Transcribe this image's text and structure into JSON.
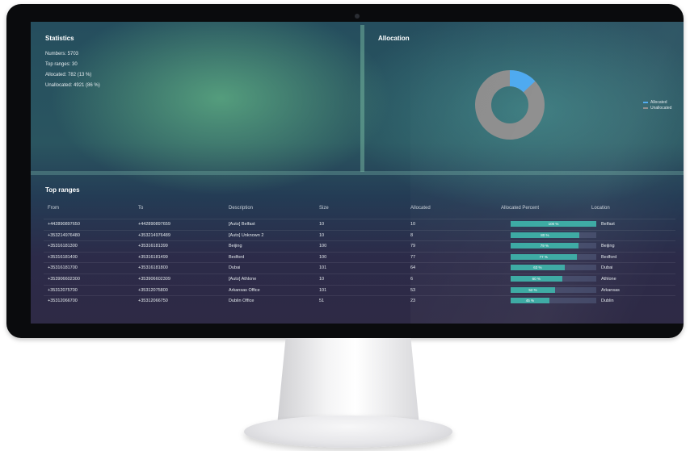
{
  "statistics": {
    "title": "Statistics",
    "lines": [
      "Numbers: 5703",
      "Top ranges: 30",
      "Allocated: 782 (13 %)",
      "Unallocated: 4921 (86 %)"
    ]
  },
  "allocation": {
    "title": "Allocation",
    "legend": [
      {
        "label": "Allocated",
        "color": "#4aa8f0"
      },
      {
        "label": "Unallocated",
        "color": "#8c8c8c"
      }
    ],
    "allocated_fraction": 0.13
  },
  "top_ranges": {
    "title": "Top ranges",
    "columns": [
      "From",
      "To",
      "Description",
      "Size",
      "Allocated",
      "Allocated Percent",
      "Location"
    ],
    "rows": [
      {
        "from": "+442890897650",
        "to": "+442890897659",
        "description": "[Auto] Belfast",
        "size": "10",
        "allocated": "10",
        "percent_label": "100 %",
        "percent": 100,
        "location": "Belfast"
      },
      {
        "from": "+353214976480",
        "to": "+353214976489",
        "description": "[Auto] Unknown 2",
        "size": "10",
        "allocated": "8",
        "percent_label": "80 %",
        "percent": 80,
        "location": ""
      },
      {
        "from": "+35316181300",
        "to": "+35316181399",
        "description": "Beijing",
        "size": "100",
        "allocated": "79",
        "percent_label": "79 %",
        "percent": 79,
        "location": "Beijing"
      },
      {
        "from": "+35316181400",
        "to": "+35316181499",
        "description": "Bedford",
        "size": "100",
        "allocated": "77",
        "percent_label": "77 %",
        "percent": 77,
        "location": "Bedford"
      },
      {
        "from": "+35316181700",
        "to": "+35316181800",
        "description": "Dubai",
        "size": "101",
        "allocated": "64",
        "percent_label": "63 %",
        "percent": 63,
        "location": "Dubai"
      },
      {
        "from": "+353906602300",
        "to": "+353906602309",
        "description": "[Auto] Athlone",
        "size": "10",
        "allocated": "6",
        "percent_label": "60 %",
        "percent": 60,
        "location": "Athlone"
      },
      {
        "from": "+35312075700",
        "to": "+35312075800",
        "description": "Arkansas Office",
        "size": "101",
        "allocated": "53",
        "percent_label": "52 %",
        "percent": 52,
        "location": "Arkansas"
      },
      {
        "from": "+35312066700",
        "to": "+35312066750",
        "description": "Dublin Office",
        "size": "51",
        "allocated": "23",
        "percent_label": "45 %",
        "percent": 45,
        "location": "Dublin"
      }
    ]
  }
}
